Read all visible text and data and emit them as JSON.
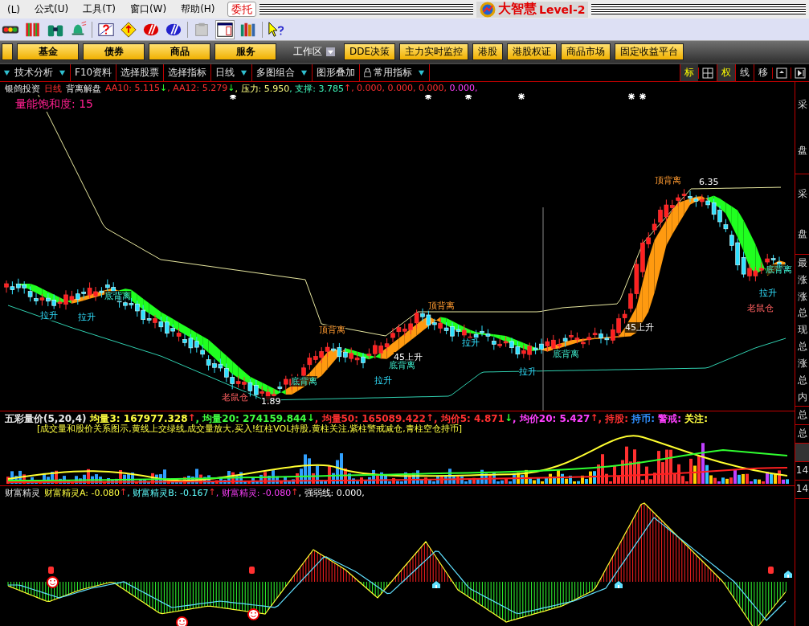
{
  "menu": [
    {
      "label": "(L)"
    },
    {
      "label": "公式(U)"
    },
    {
      "label": "工具(T)"
    },
    {
      "label": "窗口(W)"
    },
    {
      "label": "帮助(H)"
    }
  ],
  "trade_button": "委托",
  "app_title": {
    "brand": "大智慧",
    "edition": "Level-2"
  },
  "nav": {
    "buttons": [
      "基金",
      "债券",
      "商品",
      "服务"
    ],
    "workspace": "工作区",
    "buttons_right": [
      "DDE决策",
      "主力实时监控",
      "港股",
      "港股权证",
      "商品市场",
      "固定收益平台"
    ]
  },
  "func_bar": [
    {
      "label": "技术分析",
      "dropdown": true,
      "locked": false
    },
    {
      "label": "F10资料",
      "dropdown": false,
      "locked": false
    },
    {
      "label": "选择股票",
      "dropdown": false,
      "locked": false
    },
    {
      "label": "选择指标",
      "dropdown": false,
      "locked": false
    },
    {
      "label": "日线",
      "dropdown": true,
      "locked": false
    },
    {
      "label": "多图组合",
      "dropdown": true,
      "locked": false
    },
    {
      "label": "图形叠加",
      "dropdown": false,
      "locked": false
    },
    {
      "label": "常用指标",
      "dropdown": true,
      "locked": true
    }
  ],
  "tools": [
    {
      "kind": "text",
      "label": "标",
      "selected": true
    },
    {
      "kind": "grid"
    },
    {
      "kind": "text",
      "label": "权",
      "selected": true
    },
    {
      "kind": "text",
      "label": "线",
      "selected": false
    },
    {
      "kind": "text",
      "label": "移",
      "selected": false
    },
    {
      "kind": "window"
    },
    {
      "kind": "next"
    }
  ],
  "chart": {
    "stock_name": "银鸽投资",
    "period": "日线",
    "indicator": "背离解盘",
    "values": [
      {
        "text": "AA10: 5.115",
        "color": "#ff3030",
        "arrow": "↓",
        "rising": false
      },
      {
        "text": ", AA12: 5.279",
        "color": "#ff3030",
        "arrow": "↓",
        "rising": false
      },
      {
        "text": ", 压力: 5.950",
        "color": "#ffff80"
      },
      {
        "text": ", 支撑: 3.785",
        "color": "#40ffc0",
        "arrow": "↑",
        "rising": true
      },
      {
        "text": ", 0.000, 0.000, 0.000,",
        "color": "#ff3030"
      },
      {
        "text": " 0.000,",
        "color": "#ff40ff"
      }
    ],
    "saturation": "量能饱和度: 15",
    "annotations": [
      {
        "kind": "lift",
        "text": "拉升"
      },
      {
        "kind": "lift",
        "text": "拉升"
      },
      {
        "kind": "bottom",
        "text": "底背离"
      },
      {
        "kind": "rat",
        "text": "老鼠仓"
      },
      {
        "kind": "bottom",
        "text": "底背离"
      },
      {
        "kind": "price",
        "text": "1.89"
      },
      {
        "kind": "top",
        "text": "顶背离"
      },
      {
        "kind": "rise",
        "text": "45上升"
      },
      {
        "kind": "bottom",
        "text": "底背离"
      },
      {
        "kind": "lift",
        "text": "拉升"
      },
      {
        "kind": "top",
        "text": "顶背离"
      },
      {
        "kind": "lift",
        "text": "拉升"
      },
      {
        "kind": "lift",
        "text": "拉升"
      },
      {
        "kind": "bottom",
        "text": "底背离"
      },
      {
        "kind": "rise",
        "text": "45上升"
      },
      {
        "kind": "top",
        "text": "顶背离"
      },
      {
        "kind": "price",
        "text": "6.35"
      },
      {
        "kind": "bottom",
        "text": "底背离"
      },
      {
        "kind": "lift",
        "text": "拉升"
      },
      {
        "kind": "rat",
        "text": "老鼠仓"
      }
    ]
  },
  "volume": {
    "title": "五彩量价(5,20,4)",
    "values": [
      {
        "text": "均量3: 167977.328",
        "color": "#ffff40",
        "arrow": "↑",
        "rising": true
      },
      {
        "text": ", 均量20: 274159.844",
        "color": "#40ff40",
        "arrow": "↓",
        "rising": false
      },
      {
        "text": ", 均量50: 165089.422",
        "color": "#ff3030",
        "arrow": "↑",
        "rising": true
      },
      {
        "text": ", 均价5: 4.871",
        "color": "#ff3030",
        "arrow": "↓",
        "rising": false
      },
      {
        "text": ", 均价20: 5.427",
        "color": "#ff40ff",
        "arrow": "↑",
        "rising": true
      },
      {
        "text": ", 持股:",
        "color": "#ff3030"
      },
      {
        "text": " 持币:",
        "color": "#3090ff"
      },
      {
        "text": " 警戒:",
        "color": "#ff40ff"
      },
      {
        "text": " 关注:",
        "color": "#ffff40"
      }
    ],
    "note": "[成交量和股价关系图示,黄线上交绿线,成交量放大,买入!红柱VOL持股,黄柱关注,紫柱警戒减仓,青柱空仓持币]"
  },
  "oscillator": {
    "title": "财富精灵",
    "values": [
      {
        "text": "财富精灵A: -0.080",
        "color": "#ffff40",
        "arrow": "↑",
        "rising": true
      },
      {
        "text": ", 财富精灵B: -0.167",
        "color": "#60ffff",
        "arrow": "↑",
        "rising": true
      },
      {
        "text": ", 财富精灵: -0.080",
        "color": "#ff40ff",
        "arrow": "↑",
        "rising": true
      },
      {
        "text": ", 强弱线: 0.000,",
        "color": "#ffffff"
      }
    ]
  },
  "side_panel": [
    {
      "lines": [
        "采",
        "盘"
      ]
    },
    {
      "lines": [
        "采",
        "盘"
      ]
    },
    {
      "lines": [
        "最",
        "涨",
        "涨",
        "总",
        "现",
        "总",
        "涨",
        "总",
        "内"
      ]
    },
    {
      "lines": [
        "总"
      ]
    },
    {
      "lines": [
        "总"
      ]
    },
    {
      "lines": [
        "14"
      ]
    },
    {
      "lines": [
        "14"
      ]
    }
  ]
}
